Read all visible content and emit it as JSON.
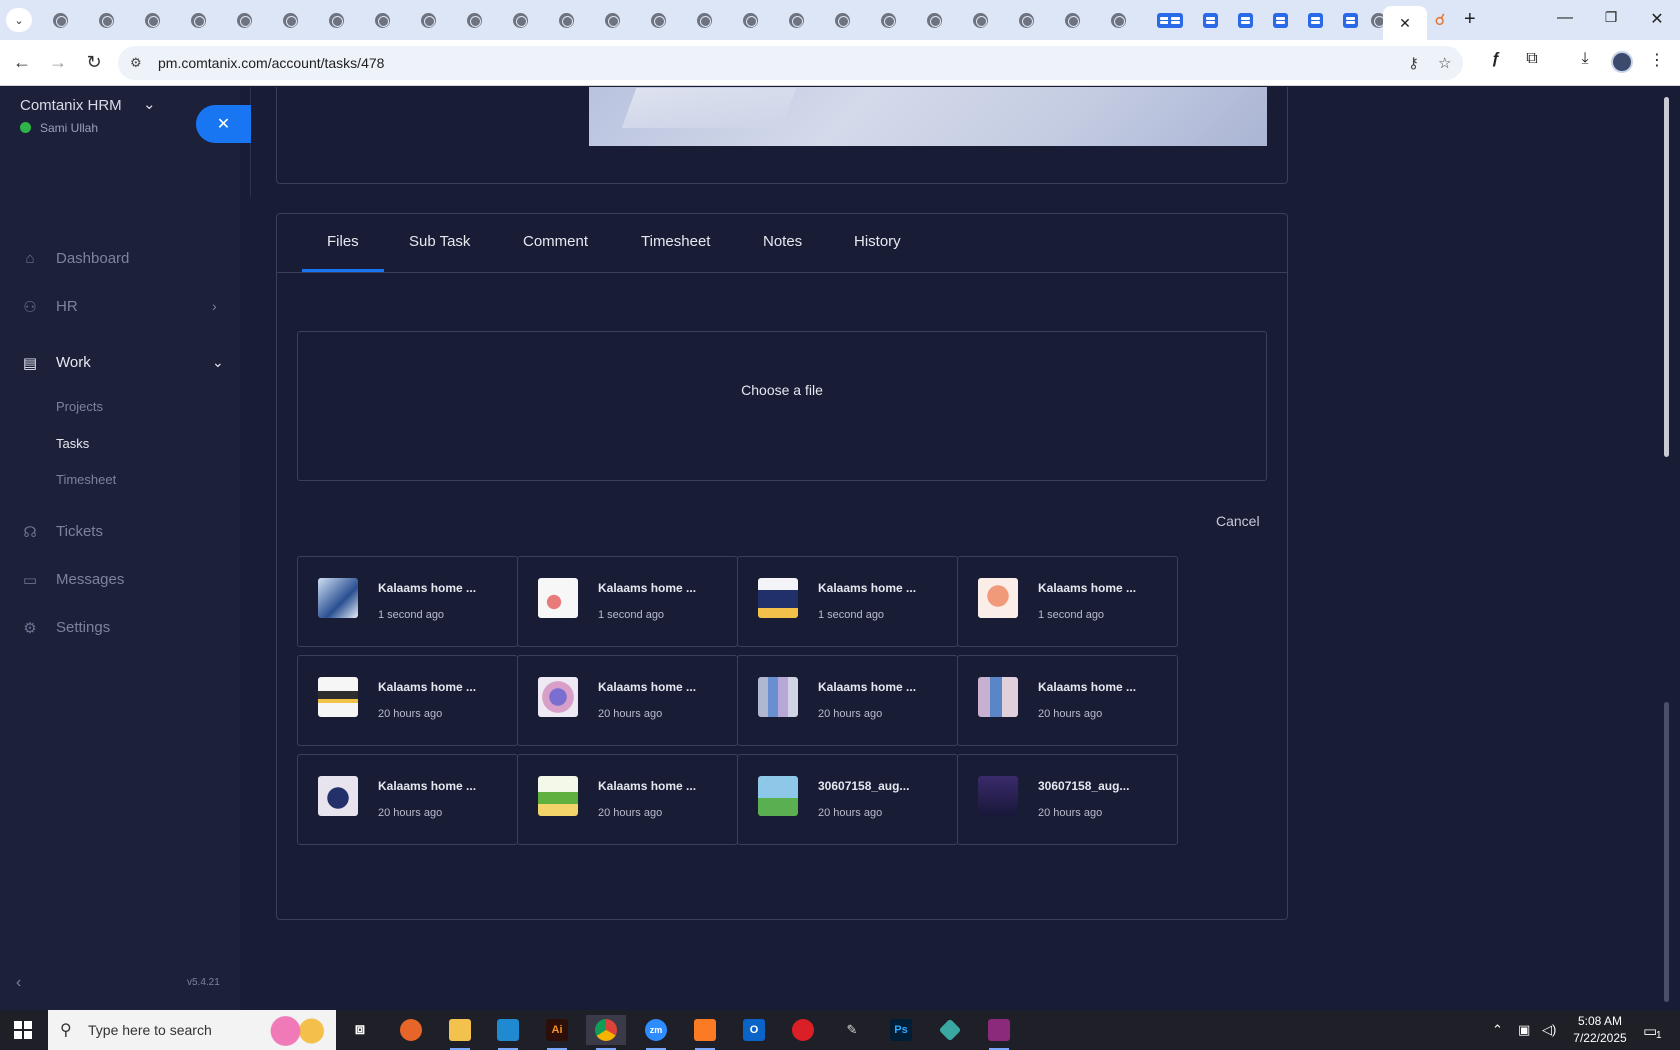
{
  "browser": {
    "url": "pm.comtanix.com/account/tasks/478",
    "active_tab_close": "✕",
    "new_tab": "+"
  },
  "sidebar": {
    "brand": "Comtanix HRM",
    "user": "Sami Ullah",
    "items": [
      {
        "label": "Dashboard",
        "icon": "home-icon"
      },
      {
        "label": "HR",
        "icon": "users-icon"
      },
      {
        "label": "Work",
        "icon": "briefcase-icon"
      },
      {
        "label": "Tickets",
        "icon": "headset-icon"
      },
      {
        "label": "Messages",
        "icon": "chat-icon"
      },
      {
        "label": "Settings",
        "icon": "gear-icon"
      }
    ],
    "work_sub": [
      "Projects",
      "Tasks",
      "Timesheet"
    ],
    "version": "v5.4.21"
  },
  "tabs": [
    "Files",
    "Sub Task",
    "Comment",
    "Timesheet",
    "Notes",
    "History"
  ],
  "upload": {
    "choose_label": "Choose a file",
    "cancel_label": "Cancel"
  },
  "files": [
    {
      "name": "Kalaams home ...",
      "time": "1 second ago"
    },
    {
      "name": "Kalaams home ...",
      "time": "1 second ago"
    },
    {
      "name": "Kalaams home ...",
      "time": "1 second ago"
    },
    {
      "name": "Kalaams home ...",
      "time": "1 second ago"
    },
    {
      "name": "Kalaams home ...",
      "time": "20 hours ago"
    },
    {
      "name": "Kalaams home ...",
      "time": "20 hours ago"
    },
    {
      "name": "Kalaams home ...",
      "time": "20 hours ago"
    },
    {
      "name": "Kalaams home ...",
      "time": "20 hours ago"
    },
    {
      "name": "Kalaams home ...",
      "time": "20 hours ago"
    },
    {
      "name": "Kalaams home ...",
      "time": "20 hours ago"
    },
    {
      "name": "30607158_aug...",
      "time": "20 hours ago"
    },
    {
      "name": "30607158_aug...",
      "time": "20 hours ago"
    }
  ],
  "taskbar": {
    "search_placeholder": "Type here to search",
    "time": "5:08 AM",
    "date": "7/22/2025",
    "notifications": "1"
  },
  "colors": {
    "accent": "#1976f2",
    "background": "#181c34",
    "online": "#2fb44a"
  }
}
